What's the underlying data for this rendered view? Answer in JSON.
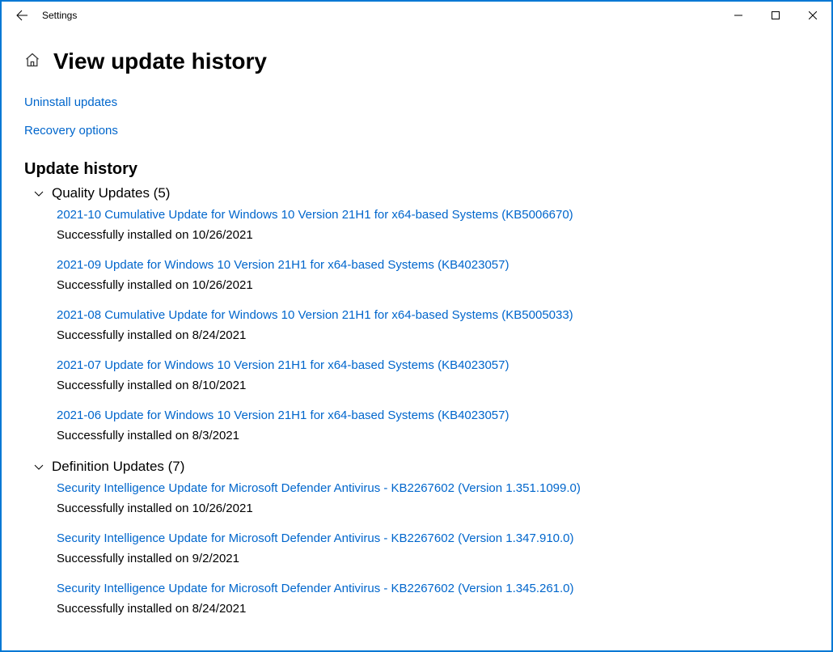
{
  "window": {
    "app_name": "Settings"
  },
  "page": {
    "title": "View update history"
  },
  "links": {
    "uninstall": "Uninstall updates",
    "recovery": "Recovery options"
  },
  "history": {
    "title": "Update history",
    "groups": [
      {
        "title": "Quality Updates (5)",
        "items": [
          {
            "title": "2021-10 Cumulative Update for Windows 10 Version 21H1 for x64-based Systems (KB5006670)",
            "status": "Successfully installed on 10/26/2021"
          },
          {
            "title": "2021-09 Update for Windows 10 Version 21H1 for x64-based Systems (KB4023057)",
            "status": "Successfully installed on 10/26/2021"
          },
          {
            "title": "2021-08 Cumulative Update for Windows 10 Version 21H1 for x64-based Systems (KB5005033)",
            "status": "Successfully installed on 8/24/2021"
          },
          {
            "title": "2021-07 Update for Windows 10 Version 21H1 for x64-based Systems (KB4023057)",
            "status": "Successfully installed on 8/10/2021"
          },
          {
            "title": "2021-06 Update for Windows 10 Version 21H1 for x64-based Systems (KB4023057)",
            "status": "Successfully installed on 8/3/2021"
          }
        ]
      },
      {
        "title": "Definition Updates (7)",
        "items": [
          {
            "title": "Security Intelligence Update for Microsoft Defender Antivirus - KB2267602 (Version 1.351.1099.0)",
            "status": "Successfully installed on 10/26/2021"
          },
          {
            "title": "Security Intelligence Update for Microsoft Defender Antivirus - KB2267602 (Version 1.347.910.0)",
            "status": "Successfully installed on 9/2/2021"
          },
          {
            "title": "Security Intelligence Update for Microsoft Defender Antivirus - KB2267602 (Version 1.345.261.0)",
            "status": "Successfully installed on 8/24/2021"
          }
        ]
      }
    ]
  }
}
